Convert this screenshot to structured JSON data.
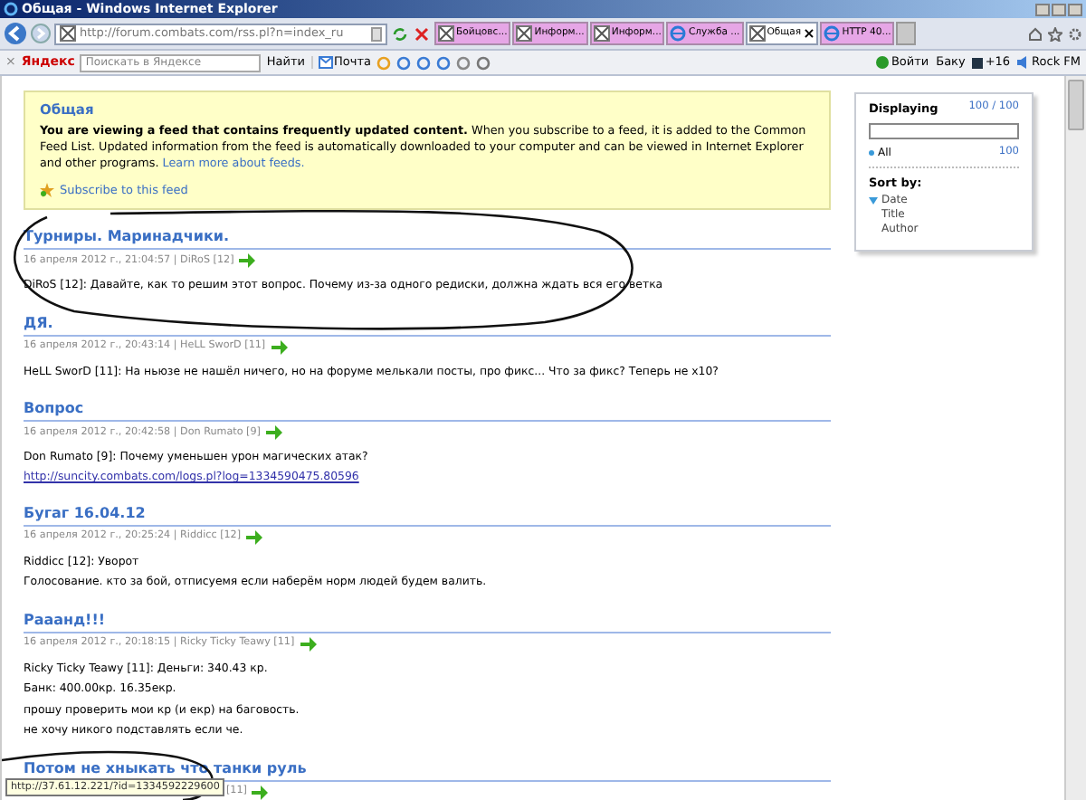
{
  "window": {
    "title": "Общая - Windows Internet Explorer"
  },
  "address_bar": {
    "url": "http://forum.combats.com/rss.pl?n=index_ru"
  },
  "tabs": [
    {
      "label": "Бойцовс...",
      "kind": "broken",
      "selected": false
    },
    {
      "label": "Информ...",
      "kind": "broken",
      "selected": false
    },
    {
      "label": "Информ...",
      "kind": "broken",
      "selected": false
    },
    {
      "label": "Служба ...",
      "kind": "ie",
      "selected": false
    },
    {
      "label": "Общая",
      "kind": "broken",
      "selected": true,
      "close": "×"
    },
    {
      "label": "HTTP 40...",
      "kind": "ie",
      "selected": false
    }
  ],
  "toolbar": {
    "close": "×",
    "brand": "Яндекс",
    "search_placeholder": "Поискать в Яндексе",
    "search_button": "Найти",
    "mail": "Почта",
    "right": [
      "Войти",
      "Баку",
      "+16",
      "Rock FM"
    ]
  },
  "feed_header": {
    "title": "Общая",
    "intro_bold": "You are viewing a feed that contains frequently updated content.",
    "intro": "When you subscribe to a feed, it is added to the Common Feed List. Updated information from the feed is automatically downloaded to your computer and can be viewed in Internet Explorer and other programs.",
    "learn_link": "Learn more about feeds.",
    "subscribe": "Subscribe to this feed"
  },
  "sidebar": {
    "title": "Displaying",
    "count": "100 / 100",
    "filter": {
      "label": "All",
      "count": "100"
    },
    "sort_title": "Sort by:",
    "sort": [
      {
        "label": "Date",
        "selected": true
      },
      {
        "label": "Title",
        "selected": false
      },
      {
        "label": "Author",
        "selected": false
      }
    ]
  },
  "entries": [
    {
      "title": "Турниры. Маринадчики.",
      "meta": "16 апреля 2012 г., 21:04:57 | DiRoS [12]",
      "lines": [
        "DiRoS [12]: Давайте, как то решим этот вопрос. Почему из-за одного редиски, должна ждать вся его ветка"
      ]
    },
    {
      "title": "ДЯ.",
      "meta": "16 апреля 2012 г., 20:43:14 | HeLL SworD [11]",
      "lines": [
        "HeLL SworD [11]: На ньюзе не нашёл ничего, но на форуме мелькали посты, про фикс... Что за фикс? Теперь не х10?"
      ]
    },
    {
      "title": "Вопрос",
      "meta": "16 апреля 2012 г., 20:42:58 | Don Rumato [9]",
      "lines": [
        "Don Rumato [9]: Почему уменьшен урон магических атак?"
      ],
      "link": "http://suncity.combats.com/logs.pl?log=1334590475.80596"
    },
    {
      "title": "Бугаг 16.04.12",
      "meta": "16 апреля 2012 г., 20:25:24 | Riddicc [12]",
      "lines": [
        "Riddicc [12]: Уворот",
        "Голосование. кто за бой, отписуемя если наберём норм людей будем валить."
      ]
    },
    {
      "title": "Рааанд!!!",
      "meta": "16 апреля 2012 г., 20:18:15 | Ricky Ticky Teawy [11]",
      "lines": [
        "Ricky Ticky Teawy [11]: Деньги: 340.43 кр.",
        "Банк: 400.00кр. 16.35екр.",
        "прошу проверить мои кр (и екр) на баговость.",
        "не хочу никого подставлять если че."
      ]
    },
    {
      "title": "Потом не хныкать что танки руль",
      "meta": "[11]"
    }
  ],
  "status_bar": {
    "text": "http://37.61.12.221/?id=1334592229600"
  }
}
